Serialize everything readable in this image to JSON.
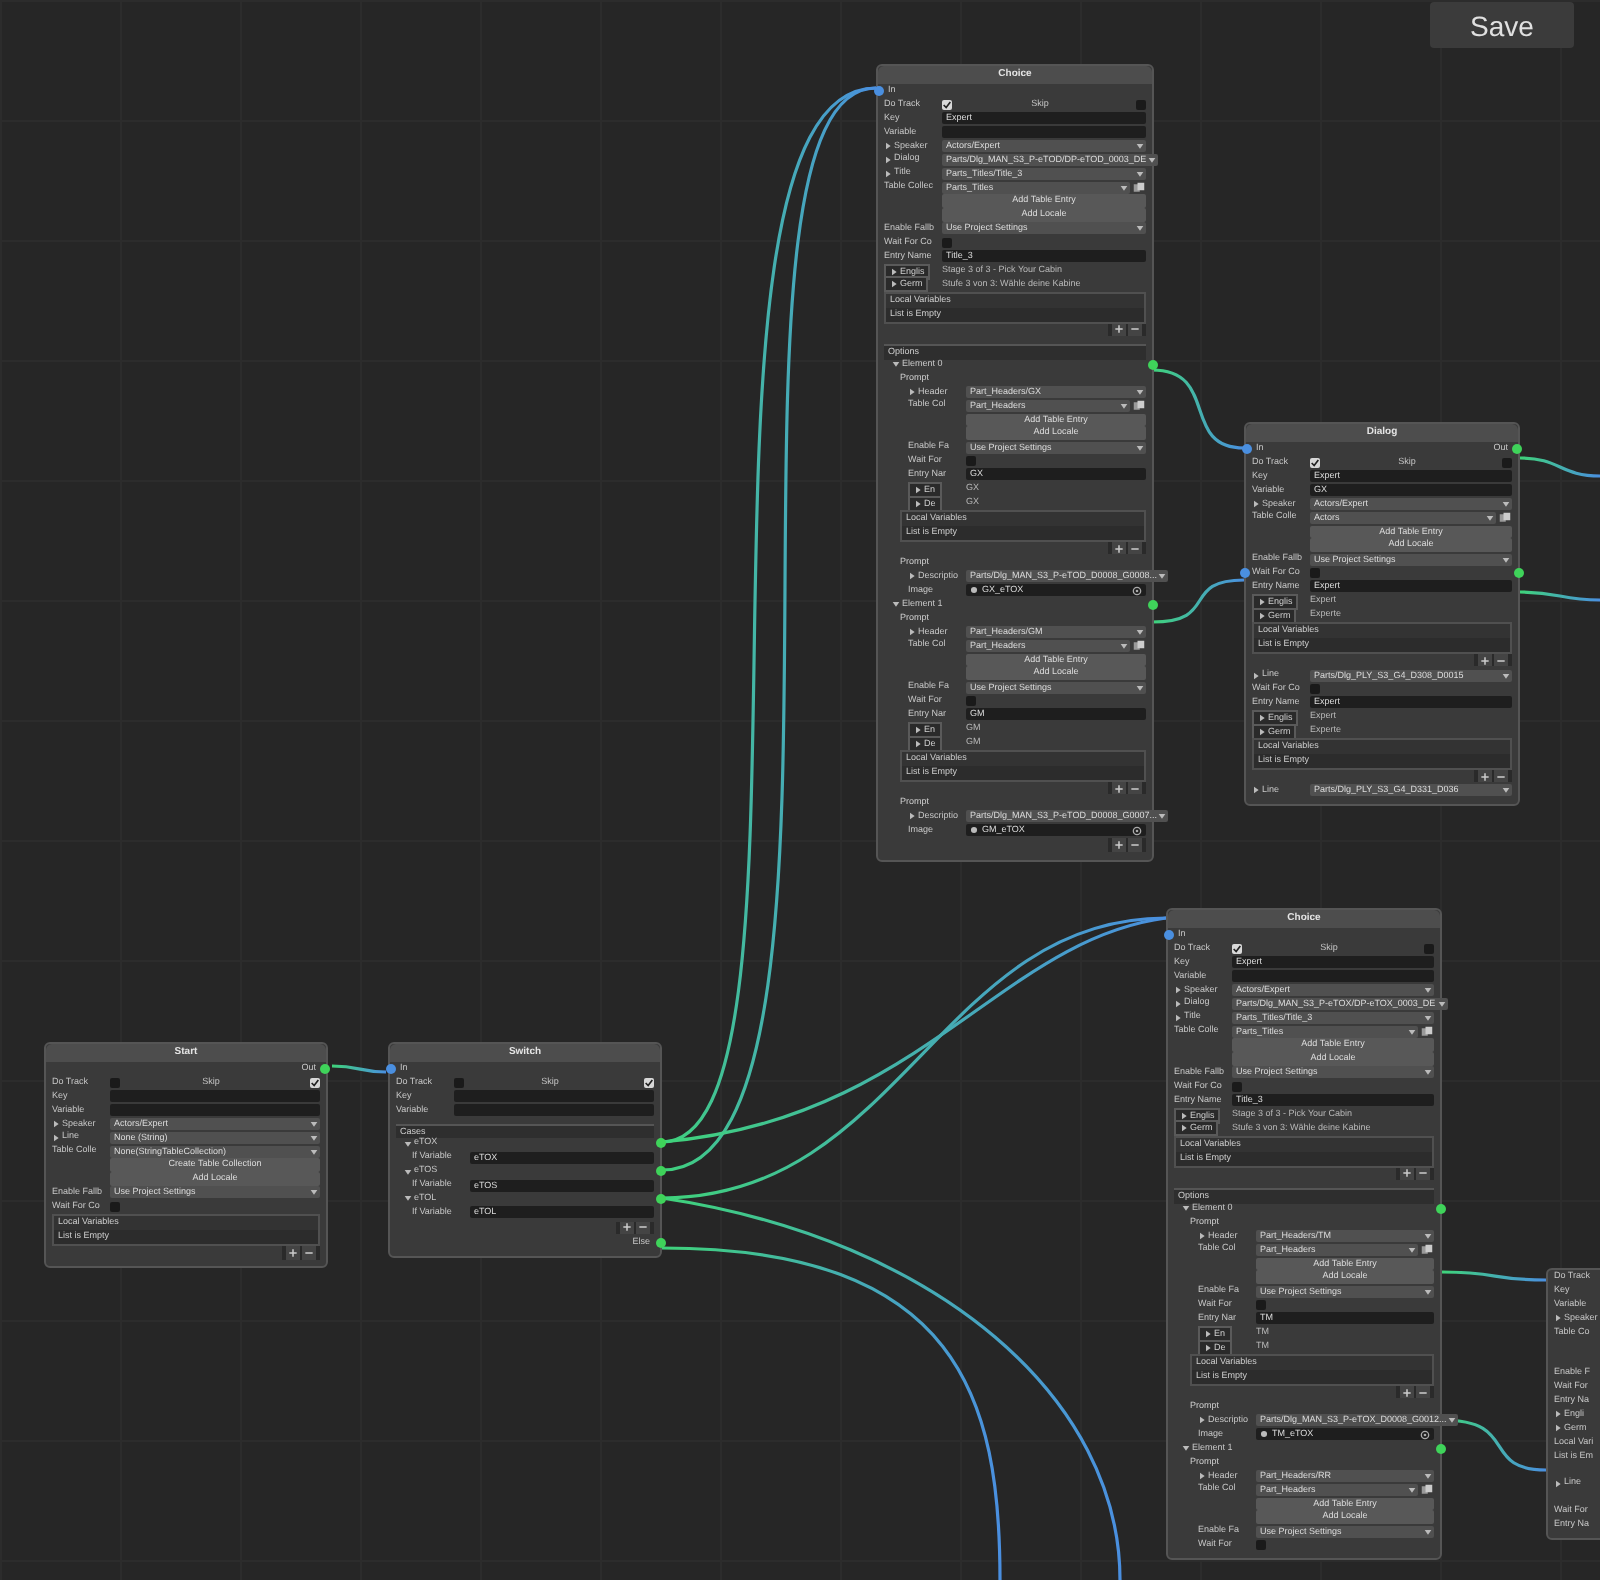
{
  "save_button": "Save",
  "nodes": [
    {
      "title": "Choice",
      "in_port": "In",
      "rows": [
        {
          "kind": "toggles",
          "items": [
            {
              "label": "Do Track",
              "checked": true
            },
            {
              "label": "Skip",
              "checked": false
            }
          ]
        },
        {
          "kind": "field",
          "label": "Key",
          "value": "Expert"
        },
        {
          "kind": "field",
          "label": "Variable"
        },
        {
          "kind": "dropdown",
          "label": "Speaker",
          "foldout": true,
          "value": "Actors/Expert"
        },
        {
          "kind": "dropdown",
          "label": "Dialog",
          "foldout": true,
          "value": "Parts/Dlg_MAN_S3_P-eTOD/DP-eTOD_0003_DE"
        },
        {
          "kind": "dropdown",
          "label": "Title",
          "foldout": true,
          "value": "Parts_Titles/Title_3"
        },
        {
          "kind": "dropdown",
          "label": "Table Collec",
          "value": "Parts_Titles",
          "picker": true
        },
        {
          "kind": "button",
          "label": "Add Table Entry"
        },
        {
          "kind": "button",
          "label": "Add Locale"
        },
        {
          "kind": "dropdown",
          "label": "Enable Fallb",
          "value": "Use Project Settings"
        },
        {
          "kind": "check",
          "label": "Wait For Co",
          "checked": false
        },
        {
          "kind": "field",
          "label": "Entry Name",
          "value": "Title_3"
        },
        {
          "kind": "locale",
          "label": "Englis",
          "value": "Stage 3 of 3 - Pick Your Cabin"
        },
        {
          "kind": "locale",
          "label": "Germ",
          "value": "Stufe 3 von 3: Wähle deine Kabine"
        },
        {
          "kind": "list",
          "label": "Local Variables",
          "note": "List is Empty"
        },
        {
          "kind": "addremove"
        },
        {
          "kind": "panel",
          "label": "Options",
          "children": [
            {
              "kind": "group",
              "label": "Element 0",
              "expanded": true,
              "has_output": true,
              "children": [
                {
                  "kind": "subhead",
                  "label": "Prompt",
                  "children": [
                    {
                      "kind": "dropdown",
                      "label": "Header",
                      "foldout": true,
                      "value": "Part_Headers/GX"
                    },
                    {
                      "kind": "dropdown",
                      "label": "Table Col",
                      "value": "Part_Headers",
                      "picker": true
                    },
                    {
                      "kind": "button",
                      "label": "Add Table Entry"
                    },
                    {
                      "kind": "button",
                      "label": "Add Locale"
                    },
                    {
                      "kind": "dropdown",
                      "label": "Enable Fa",
                      "value": "Use Project Settings"
                    },
                    {
                      "kind": "check",
                      "label": "Wait For",
                      "checked": false
                    },
                    {
                      "kind": "field",
                      "label": "Entry Nar",
                      "value": "GX"
                    },
                    {
                      "kind": "locale",
                      "label": "En",
                      "value": "GX"
                    },
                    {
                      "kind": "locale",
                      "label": "De",
                      "value": "GX"
                    }
                  ]
                },
                {
                  "kind": "list",
                  "label": "Local Variables",
                  "note": "List is Empty"
                },
                {
                  "kind": "addremove"
                },
                {
                  "kind": "subhead",
                  "label": "Prompt",
                  "children": [
                    {
                      "kind": "dropdown",
                      "label": "Descriptio",
                      "foldout": true,
                      "value": "Parts/Dlg_MAN_S3_P-eTOD_D0008_G0008..."
                    },
                    {
                      "kind": "object",
                      "label": "Image",
                      "value": "GX_eTOX"
                    }
                  ]
                }
              ]
            },
            {
              "kind": "group",
              "label": "Element 1",
              "expanded": true,
              "has_output": true,
              "children": [
                {
                  "kind": "subhead",
                  "label": "Prompt",
                  "children": [
                    {
                      "kind": "dropdown",
                      "label": "Header",
                      "foldout": true,
                      "value": "Part_Headers/GM"
                    },
                    {
                      "kind": "dropdown",
                      "label": "Table Col",
                      "value": "Part_Headers",
                      "picker": true
                    },
                    {
                      "kind": "button",
                      "label": "Add Table Entry"
                    },
                    {
                      "kind": "button",
                      "label": "Add Locale"
                    },
                    {
                      "kind": "dropdown",
                      "label": "Enable Fa",
                      "value": "Use Project Settings"
                    },
                    {
                      "kind": "check",
                      "label": "Wait For",
                      "checked": false
                    },
                    {
                      "kind": "field",
                      "label": "Entry Nar",
                      "value": "GM"
                    },
                    {
                      "kind": "locale",
                      "label": "En",
                      "value": "GM"
                    },
                    {
                      "kind": "locale",
                      "label": "De",
                      "value": "GM"
                    }
                  ]
                },
                {
                  "kind": "list",
                  "label": "Local Variables",
                  "note": "List is Empty"
                },
                {
                  "kind": "addremove"
                },
                {
                  "kind": "subhead",
                  "label": "Prompt",
                  "children": [
                    {
                      "kind": "dropdown",
                      "label": "Descriptio",
                      "foldout": true,
                      "value": "Parts/Dlg_MAN_S3_P-eTOD_D0008_G0007..."
                    },
                    {
                      "kind": "object",
                      "label": "Image",
                      "value": "GM_eTOX"
                    }
                  ]
                }
              ]
            }
          ]
        },
        {
          "kind": "addremove"
        }
      ]
    },
    {
      "title": "Dialog",
      "in_port": "In",
      "out_port": "Out",
      "rows": [
        {
          "kind": "toggles",
          "items": [
            {
              "label": "Do Track",
              "checked": true
            },
            {
              "label": "Skip",
              "checked": false
            }
          ]
        },
        {
          "kind": "field",
          "label": "Key",
          "value": "Expert"
        },
        {
          "kind": "field",
          "label": "Variable",
          "value": "GX"
        },
        {
          "kind": "dropdown",
          "label": "Speaker",
          "foldout": true,
          "value": "Actors/Expert"
        },
        {
          "kind": "dropdown",
          "label": "Table Colle",
          "value": "Actors",
          "picker": true
        },
        {
          "kind": "button",
          "label": "Add Table Entry"
        },
        {
          "kind": "button",
          "label": "Add Locale"
        },
        {
          "kind": "dropdown",
          "label": "Enable Fallb",
          "value": "Use Project Settings"
        },
        {
          "kind": "check",
          "label": "Wait For Co",
          "checked": false,
          "has_input": true,
          "has_output": true
        },
        {
          "kind": "field",
          "label": "Entry Name",
          "value": "Expert"
        },
        {
          "kind": "locale",
          "label": "Englis",
          "value": "Expert"
        },
        {
          "kind": "locale",
          "label": "Germ",
          "value": "Experte"
        },
        {
          "kind": "list",
          "label": "Local Variables",
          "note": "List is Empty"
        },
        {
          "kind": "addremove"
        },
        {
          "kind": "dropdown",
          "label": "Line",
          "foldout": true,
          "value": "Parts/Dlg_PLY_S3_G4_D308_D0015"
        },
        {
          "kind": "check",
          "label": "Wait For Co",
          "checked": false
        },
        {
          "kind": "field",
          "label": "Entry Name",
          "value": "Expert"
        },
        {
          "kind": "locale",
          "label": "Englis",
          "value": "Expert"
        },
        {
          "kind": "locale",
          "label": "Germ",
          "value": "Experte"
        },
        {
          "kind": "list",
          "label": "Local Variables",
          "note": "List is Empty"
        },
        {
          "kind": "addremove"
        },
        {
          "kind": "dropdown",
          "label": "Line",
          "foldout": true,
          "value": "Parts/Dlg_PLY_S3_G4_D331_D036"
        }
      ]
    },
    {
      "title": "Choice",
      "in_port": "In",
      "rows": [
        {
          "kind": "toggles",
          "items": [
            {
              "label": "Do Track",
              "checked": true
            },
            {
              "label": "Skip",
              "checked": false
            }
          ]
        },
        {
          "kind": "field",
          "label": "Key",
          "value": "Expert"
        },
        {
          "kind": "field",
          "label": "Variable"
        },
        {
          "kind": "dropdown",
          "label": "Speaker",
          "foldout": true,
          "value": "Actors/Expert"
        },
        {
          "kind": "dropdown",
          "label": "Dialog",
          "foldout": true,
          "value": "Parts/Dlg_MAN_S3_P-eTOX/DP-eTOX_0003_DE"
        },
        {
          "kind": "dropdown",
          "label": "Title",
          "foldout": true,
          "value": "Parts_Titles/Title_3"
        },
        {
          "kind": "dropdown",
          "label": "Table Colle",
          "value": "Parts_Titles",
          "picker": true
        },
        {
          "kind": "button",
          "label": "Add Table Entry"
        },
        {
          "kind": "button",
          "label": "Add Locale"
        },
        {
          "kind": "dropdown",
          "label": "Enable Fallb",
          "value": "Use Project Settings"
        },
        {
          "kind": "check",
          "label": "Wait For Co",
          "checked": false
        },
        {
          "kind": "field",
          "label": "Entry Name",
          "value": "Title_3"
        },
        {
          "kind": "locale",
          "label": "Englis",
          "value": "Stage 3 of 3 - Pick Your Cabin"
        },
        {
          "kind": "locale",
          "label": "Germ",
          "value": "Stufe 3 von 3: Wähle deine Kabine"
        },
        {
          "kind": "list",
          "label": "Local Variables",
          "note": "List is Empty"
        },
        {
          "kind": "addremove"
        },
        {
          "kind": "panel",
          "label": "Options",
          "children": [
            {
              "kind": "group",
              "label": "Element 0",
              "expanded": true,
              "has_output": true,
              "children": [
                {
                  "kind": "subhead",
                  "label": "Prompt",
                  "children": [
                    {
                      "kind": "dropdown",
                      "label": "Header",
                      "foldout": true,
                      "value": "Part_Headers/TM"
                    },
                    {
                      "kind": "dropdown",
                      "label": "Table Col",
                      "value": "Part_Headers",
                      "picker": true
                    },
                    {
                      "kind": "button",
                      "label": "Add Table Entry"
                    },
                    {
                      "kind": "button",
                      "label": "Add Locale"
                    },
                    {
                      "kind": "dropdown",
                      "label": "Enable Fa",
                      "value": "Use Project Settings"
                    },
                    {
                      "kind": "check",
                      "label": "Wait For",
                      "checked": false
                    },
                    {
                      "kind": "field",
                      "label": "Entry Nar",
                      "value": "TM"
                    },
                    {
                      "kind": "locale",
                      "label": "En",
                      "value": "TM"
                    },
                    {
                      "kind": "locale",
                      "label": "De",
                      "value": "TM"
                    }
                  ]
                },
                {
                  "kind": "list",
                  "label": "Local Variables",
                  "note": "List is Empty"
                },
                {
                  "kind": "addremove"
                },
                {
                  "kind": "subhead",
                  "label": "Prompt",
                  "children": [
                    {
                      "kind": "dropdown",
                      "label": "Descriptio",
                      "foldout": true,
                      "value": "Parts/Dlg_MAN_S3_P-eTOX_D0008_G0012..."
                    },
                    {
                      "kind": "object",
                      "label": "Image",
                      "value": "TM_eTOX"
                    }
                  ]
                }
              ]
            },
            {
              "kind": "group",
              "label": "Element 1",
              "expanded": true,
              "has_output": true,
              "children": [
                {
                  "kind": "subhead",
                  "label": "Prompt",
                  "children": [
                    {
                      "kind": "dropdown",
                      "label": "Header",
                      "foldout": true,
                      "value": "Part_Headers/RR"
                    },
                    {
                      "kind": "dropdown",
                      "label": "Table Col",
                      "value": "Part_Headers",
                      "picker": true
                    },
                    {
                      "kind": "button",
                      "label": "Add Table Entry"
                    },
                    {
                      "kind": "button",
                      "label": "Add Locale"
                    },
                    {
                      "kind": "dropdown",
                      "label": "Enable Fa",
                      "value": "Use Project Settings"
                    },
                    {
                      "kind": "check",
                      "label": "Wait For",
                      "checked": false
                    }
                  ]
                }
              ]
            }
          ]
        }
      ]
    },
    {
      "title": "Start",
      "out_port": "Out",
      "rows": [
        {
          "kind": "toggles",
          "items": [
            {
              "label": "Do Track",
              "checked": false
            },
            {
              "label": "Skip",
              "checked": true
            }
          ]
        },
        {
          "kind": "field",
          "label": "Key"
        },
        {
          "kind": "field",
          "label": "Variable"
        },
        {
          "kind": "dropdown",
          "label": "Speaker",
          "foldout": true,
          "value": "Actors/Expert"
        },
        {
          "kind": "dropdown",
          "label": "Line",
          "foldout": true,
          "value": "None (String)"
        },
        {
          "kind": "dropdown",
          "label": "Table Colle",
          "value": "None(StringTableCollection)"
        },
        {
          "kind": "button",
          "label": "Create Table Collection"
        },
        {
          "kind": "button",
          "label": "Add Locale"
        },
        {
          "kind": "dropdown",
          "label": "Enable Fallb",
          "value": "Use Project Settings"
        },
        {
          "kind": "check",
          "label": "Wait For Co",
          "checked": false
        },
        {
          "kind": "list",
          "label": "Local Variables",
          "note": "List is Empty"
        },
        {
          "kind": "addremove"
        }
      ]
    },
    {
      "title": "Switch",
      "in_port": "In",
      "rows": [
        {
          "kind": "toggles",
          "items": [
            {
              "label": "Do Track",
              "checked": false
            },
            {
              "label": "Skip",
              "checked": true
            }
          ]
        },
        {
          "kind": "field",
          "label": "Key"
        },
        {
          "kind": "field",
          "label": "Variable"
        },
        {
          "kind": "panel",
          "label": "Cases",
          "children": [
            {
              "kind": "group",
              "label": "eTOX",
              "expanded": true,
              "has_output": true,
              "children": [
                {
                  "kind": "field",
                  "label": "If Variable",
                  "value": "eTOX"
                }
              ]
            },
            {
              "kind": "group",
              "label": "eTOS",
              "expanded": true,
              "has_output": true,
              "children": [
                {
                  "kind": "field",
                  "label": "If Variable",
                  "value": "eTOS"
                }
              ]
            },
            {
              "kind": "group",
              "label": "eTOL",
              "expanded": true,
              "has_output": true,
              "children": [
                {
                  "kind": "field",
                  "label": "If Variable",
                  "value": "eTOL"
                }
              ]
            }
          ]
        },
        {
          "kind": "addremove"
        },
        {
          "kind": "outlet",
          "label": "Else",
          "has_output": true
        }
      ]
    },
    {
      "rows": [
        {
          "kind": "stub",
          "label": "Do Track"
        },
        {
          "kind": "stub",
          "label": "Key"
        },
        {
          "kind": "stub",
          "label": "Variable"
        },
        {
          "kind": "stub",
          "label": "Speaker",
          "foldout": true
        },
        {
          "kind": "stub",
          "label": "Table Co"
        },
        {
          "kind": "spacer"
        },
        {
          "kind": "spacer"
        },
        {
          "kind": "stub",
          "label": "Enable F"
        },
        {
          "kind": "stub",
          "label": "Wait For"
        },
        {
          "kind": "stub",
          "label": "Entry Na"
        },
        {
          "kind": "stub",
          "label": "Engli",
          "foldout": true
        },
        {
          "kind": "stub",
          "label": "Germ",
          "foldout": true
        },
        {
          "kind": "stub",
          "label": "Local Vari"
        },
        {
          "kind": "stub",
          "label": "List is Em"
        },
        {
          "kind": "spacer"
        },
        {
          "kind": "stub",
          "label": "Line",
          "foldout": true
        },
        {
          "kind": "spacer"
        },
        {
          "kind": "stub",
          "label": "Wait For"
        },
        {
          "kind": "stub",
          "label": "Entry Na"
        }
      ]
    }
  ]
}
